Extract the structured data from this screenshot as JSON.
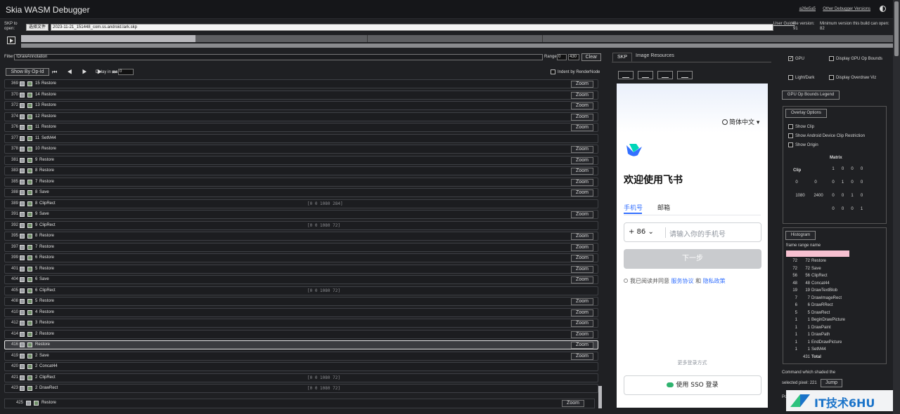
{
  "header": {
    "title": "Skia WASM Debugger",
    "version_link": "a26e5a5",
    "other_versions_link": "Other Debugger Versions"
  },
  "file": {
    "skp_label": "SKP to open:",
    "choose_button": "选择文件",
    "file_name": "2023-11-21_151448_com.ss.android.lark.skp",
    "user_guide": "User Guide",
    "file_version": "file version: 91",
    "min_version": "Minimum version this build can open: 82"
  },
  "timeline": {
    "frame_progress": 0.2
  },
  "filter": {
    "label": "Filter",
    "value": "!DrawAnnotation",
    "range_label": "Range",
    "range_start": "0",
    "range_end": "430",
    "clear_label": "Clear"
  },
  "controls": {
    "group_button": "Show By Op-Id",
    "nav": "⏮ ◀ ▶ ▶ ⏭",
    "delay_label": "Delay in ms",
    "delay_value": "0",
    "indent_label": "Indent by RenderNode"
  },
  "commands": [
    {
      "idx": "369",
      "depth": "15",
      "name": "Restore",
      "detail": "",
      "zoom": true
    },
    {
      "idx": "370",
      "depth": "14",
      "name": "Restore",
      "detail": "",
      "zoom": true
    },
    {
      "idx": "372",
      "depth": "13",
      "name": "Restore",
      "detail": "",
      "zoom": true
    },
    {
      "idx": "374",
      "depth": "12",
      "name": "Restore",
      "detail": "",
      "zoom": true
    },
    {
      "idx": "376",
      "depth": "11",
      "name": "Restore",
      "detail": "",
      "zoom": true
    },
    {
      "idx": "377",
      "depth": "11",
      "name": "SetM44",
      "detail": "",
      "zoom": false
    },
    {
      "idx": "378",
      "depth": "10",
      "name": "Restore",
      "detail": "",
      "zoom": true
    },
    {
      "idx": "381",
      "depth": "9",
      "name": "Restore",
      "detail": "",
      "zoom": true
    },
    {
      "idx": "383",
      "depth": "8",
      "name": "Restore",
      "detail": "",
      "zoom": true
    },
    {
      "idx": "385",
      "depth": "7",
      "name": "Restore",
      "detail": "",
      "zoom": true
    },
    {
      "idx": "388",
      "depth": "8",
      "name": "Save",
      "detail": "",
      "zoom": true
    },
    {
      "idx": "389",
      "depth": "8",
      "name": "ClipRect",
      "detail": "[0 0 1080 284]",
      "zoom": false
    },
    {
      "idx": "391",
      "depth": "9",
      "name": "Save",
      "detail": "",
      "zoom": true
    },
    {
      "idx": "392",
      "depth": "9",
      "name": "ClipRect",
      "detail": "[0 0 1080 72]",
      "zoom": false
    },
    {
      "idx": "395",
      "depth": "8",
      "name": "Restore",
      "detail": "",
      "zoom": true
    },
    {
      "idx": "397",
      "depth": "7",
      "name": "Restore",
      "detail": "",
      "zoom": true
    },
    {
      "idx": "399",
      "depth": "6",
      "name": "Restore",
      "detail": "",
      "zoom": true
    },
    {
      "idx": "401",
      "depth": "5",
      "name": "Restore",
      "detail": "",
      "zoom": true
    },
    {
      "idx": "404",
      "depth": "6",
      "name": "Save",
      "detail": "",
      "zoom": true
    },
    {
      "idx": "405",
      "depth": "6",
      "name": "ClipRect",
      "detail": "[0 0 1080 72]",
      "zoom": false
    },
    {
      "idx": "408",
      "depth": "5",
      "name": "Restore",
      "detail": "",
      "zoom": true
    },
    {
      "idx": "410",
      "depth": "4",
      "name": "Restore",
      "detail": "",
      "zoom": true
    },
    {
      "idx": "412",
      "depth": "3",
      "name": "Restore",
      "detail": "",
      "zoom": true
    },
    {
      "idx": "414",
      "depth": "2",
      "name": "Restore",
      "detail": "",
      "zoom": true
    },
    {
      "idx": "416",
      "depth": "",
      "name": "Restore",
      "detail": "",
      "zoom": true,
      "selected": true
    },
    {
      "idx": "419",
      "depth": "2",
      "name": "Save",
      "detail": "",
      "zoom": true
    },
    {
      "idx": "420",
      "depth": "2",
      "name": "Concat44",
      "detail": "",
      "zoom": false
    },
    {
      "idx": "421",
      "depth": "2",
      "name": "ClipRect",
      "detail": "[0 0 1080 72]",
      "zoom": false
    },
    {
      "idx": "423",
      "depth": "2",
      "name": "DrawRect",
      "detail": "[0 0 1080 72]",
      "zoom": false
    }
  ],
  "zoom_label": "Zoom",
  "bottom_command": {
    "idx": "425",
    "name": "Restore",
    "zoom": "Zoom"
  },
  "tabs": {
    "skp": "SKP",
    "images": "Image Resources"
  },
  "preview": {
    "language": "简体中文",
    "welcome": "欢迎使用飞书",
    "tab_phone": "手机号",
    "tab_email": "邮箱",
    "country_code": "+ 86",
    "phone_placeholder": "请输入你的手机号",
    "next_button": "下一步",
    "agree_prefix": "我已阅读并同意",
    "service_link": "服务协议",
    "and": "和",
    "privacy_link": "隐私政策",
    "more_login": "更多登录方式",
    "sso_button": "使用 SSO 登录"
  },
  "settings": {
    "gpu": "GPU",
    "gpu_op_bounds": "Display GPU Op Bounds",
    "light_dark": "Light/Dark",
    "overdraw": "Display Overdraw Viz",
    "gpu_legend": "GPU Op Bounds Legend",
    "overlay_options": "Overlay Options",
    "show_clip": "Show Clip",
    "show_android_clip": "Show Android Device Clip Restriction",
    "show_origin": "Show Origin",
    "matrix_title": "Matrix",
    "clip_title": "Clip",
    "clip_values": [
      "0",
      "0",
      "1080",
      "2400"
    ],
    "matrix_rows": [
      [
        "1",
        "0",
        "0",
        "0"
      ],
      [
        "0",
        "1",
        "0",
        "0"
      ],
      [
        "0",
        "0",
        "1",
        "0"
      ],
      [
        "0",
        "0",
        "0",
        "1"
      ]
    ]
  },
  "histogram": {
    "button": "Histogram",
    "header": "frame range name",
    "rows": [
      {
        "frame": "72",
        "range": "72",
        "name": "Restore"
      },
      {
        "frame": "72",
        "range": "72",
        "name": "Save"
      },
      {
        "frame": "56",
        "range": "56",
        "name": "ClipRect"
      },
      {
        "frame": "48",
        "range": "48",
        "name": "Concat44"
      },
      {
        "frame": "19",
        "range": "19",
        "name": "DrawTextBlob"
      },
      {
        "frame": "7",
        "range": "7",
        "name": "DrawImageRect"
      },
      {
        "frame": "6",
        "range": "6",
        "name": "DrawRRect"
      },
      {
        "frame": "5",
        "range": "5",
        "name": "DrawRect"
      },
      {
        "frame": "1",
        "range": "1",
        "name": "BeginDrawPicture"
      },
      {
        "frame": "1",
        "range": "1",
        "name": "DrawPaint"
      },
      {
        "frame": "1",
        "range": "1",
        "name": "DrawPath"
      },
      {
        "frame": "1",
        "range": "1",
        "name": "EndDrawPicture"
      },
      {
        "frame": "1",
        "range": "1",
        "name": "SetM44"
      }
    ],
    "total_count": "431",
    "total_label": "Total"
  },
  "shaded": {
    "label": "Command which shaded the",
    "pixel_label": "selected pixel: 221",
    "jump": "Jump"
  },
  "edge_label": "Po",
  "watermark": "IT技术6HU"
}
